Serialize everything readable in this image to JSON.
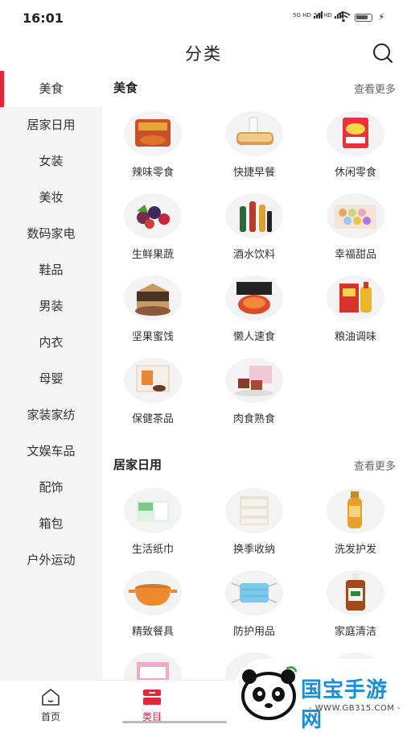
{
  "status_bar": {
    "time": "16:01",
    "signal1": "5G HD",
    "signal2": "5G HD"
  },
  "header": {
    "title": "分类"
  },
  "sidebar": {
    "items": [
      {
        "label": "美食",
        "active": true
      },
      {
        "label": "居家日用"
      },
      {
        "label": "女装"
      },
      {
        "label": "美妆"
      },
      {
        "label": "数码家电"
      },
      {
        "label": "鞋品"
      },
      {
        "label": "男装"
      },
      {
        "label": "内衣"
      },
      {
        "label": "母婴"
      },
      {
        "label": "家装家纺"
      },
      {
        "label": "文娱车品"
      },
      {
        "label": "配饰"
      },
      {
        "label": "箱包"
      },
      {
        "label": "户外运动"
      }
    ]
  },
  "sections": [
    {
      "title": "美食",
      "more": "查看更多",
      "items": [
        "辣味零食",
        "快捷早餐",
        "休闲零食",
        "生鲜果蔬",
        "酒水饮料",
        "幸福甜品",
        "坚果蜜饯",
        "懒人速食",
        "粮油调味",
        "保健茶品",
        "肉食熟食"
      ]
    },
    {
      "title": "居家日用",
      "more": "查看更多",
      "items": [
        "生活纸巾",
        "换季收纳",
        "洗发护发",
        "精致餐具",
        "防护用品",
        "家庭清洁",
        "",
        "",
        ""
      ]
    }
  ],
  "tabbar": {
    "tabs": [
      {
        "label": "首页"
      },
      {
        "label": "类目",
        "active": true
      }
    ]
  },
  "watermark": {
    "name": "国宝手游网",
    "url": "- WWW.GB315.COM -"
  },
  "colors": {
    "accent": "#e0283a",
    "watermark": "#1a8fd9"
  }
}
